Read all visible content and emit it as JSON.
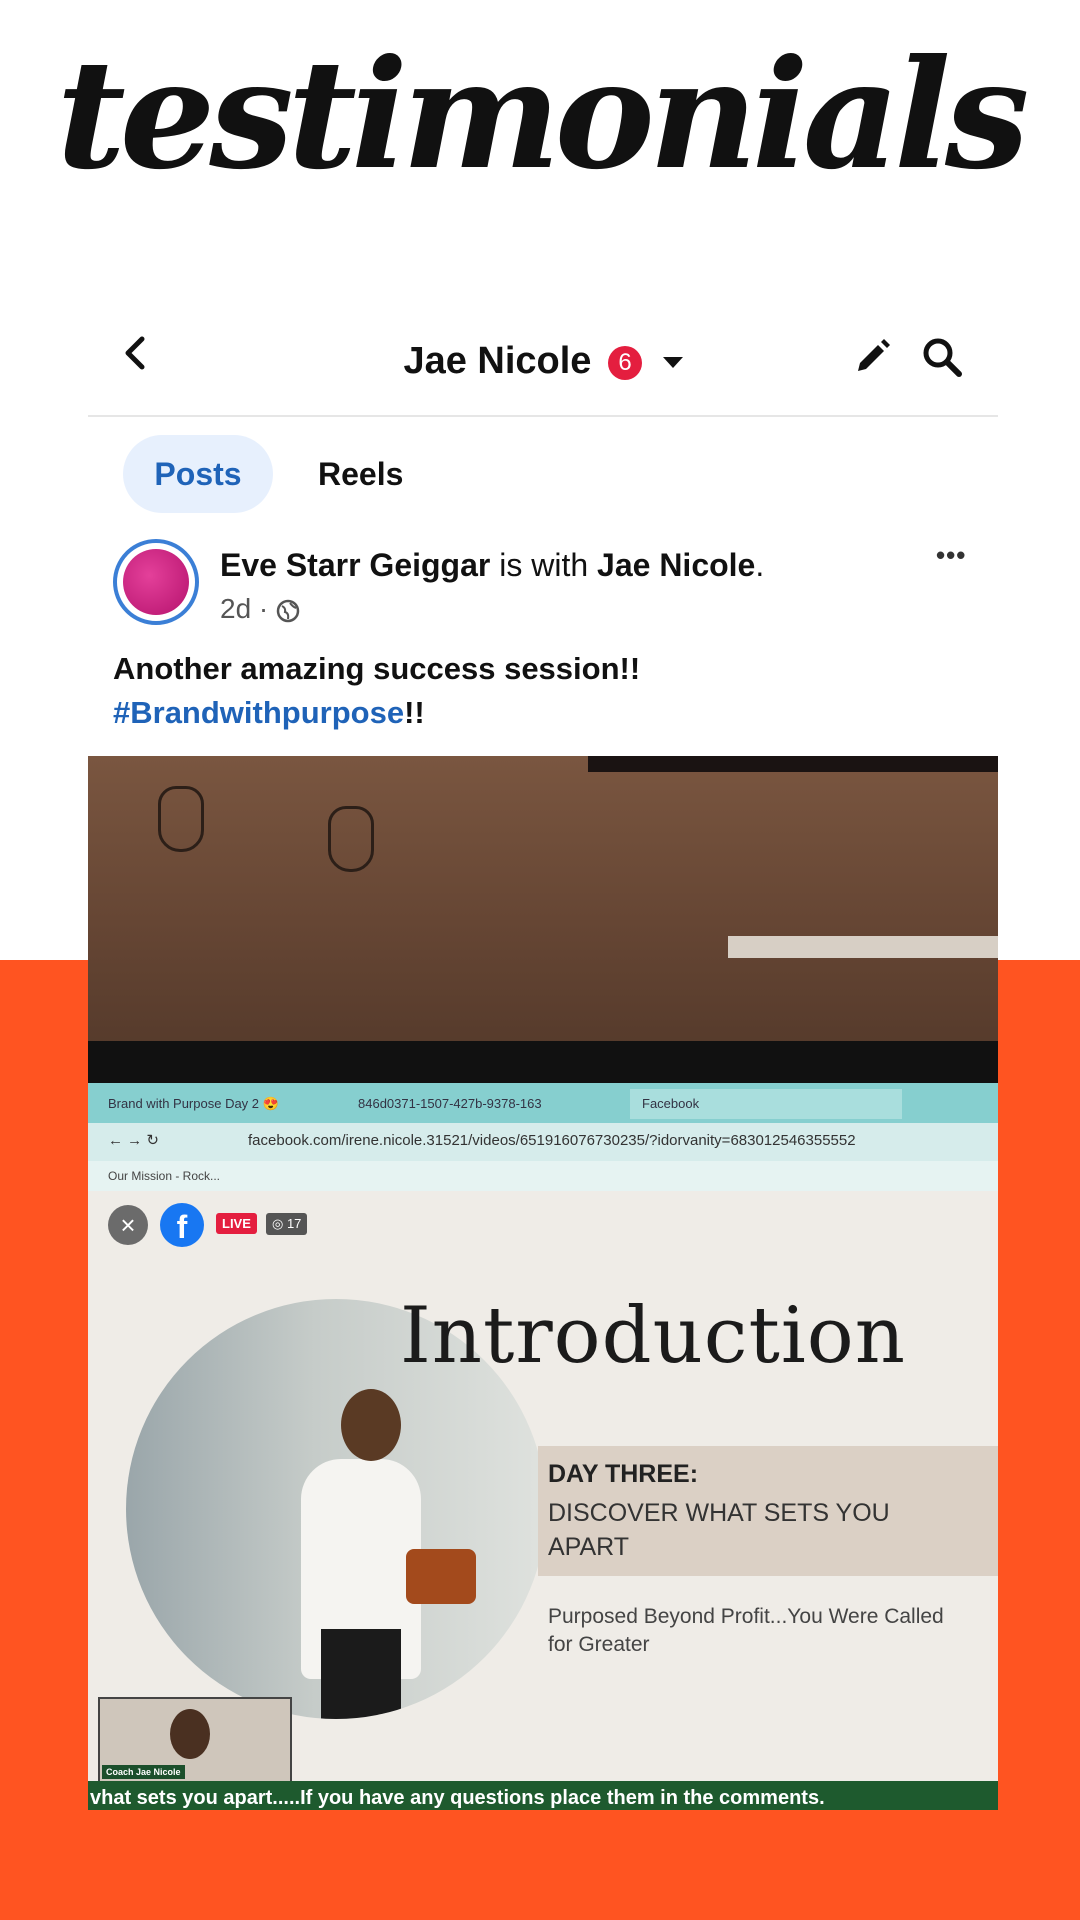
{
  "headline": "testimonials",
  "colors": {
    "accent_orange": "#ff5421",
    "fb_blue": "#1f63b8",
    "badge_red": "#e41e3f"
  },
  "header": {
    "title": "Jae Nicole",
    "notification_count": "6",
    "icons": [
      "back-arrow-icon",
      "chevron-down-icon",
      "pencil-icon",
      "search-icon"
    ]
  },
  "tabs": [
    {
      "label": "Posts",
      "active": true
    },
    {
      "label": "Reels",
      "active": false
    }
  ],
  "post": {
    "author": "Eve Starr Geiggar",
    "with_text": " is with ",
    "tagged": "Jae Nicole",
    "period": ".",
    "time": "2d · ",
    "more": "•••",
    "text": "Another amazing success session!!",
    "hashtag": "#Brandwithpurpose",
    "hashtag_suffix": "!!"
  },
  "screen": {
    "browser_tabs": [
      "Brand with Purpose Day 2 😍",
      "846d0371-1507-427b-9378-163",
      "Facebook"
    ],
    "address": "facebook.com/irene.nicole.31521/videos/651916076730235/?idorvanity=683012546355552",
    "bookmark": "Our Mission - Rock...",
    "live_label": "LIVE",
    "viewer_count": "◎ 17",
    "slide_title": "Introduction",
    "day_label": "DAY THREE:",
    "day_subtitle": "DISCOVER WHAT SETS YOU APART",
    "tagline": "Purposed Beyond Profit...You Were Called for Greater",
    "pip_name": "Coach Jae Nicole",
    "caption": "vhat sets you apart.....If you have any questions place them in the comments."
  }
}
